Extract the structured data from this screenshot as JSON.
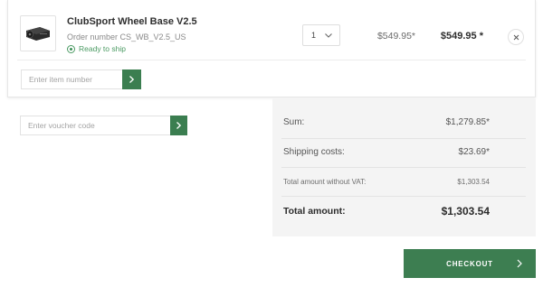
{
  "cart": {
    "item": {
      "product_name": "ClubSport Wheel Base V2.5",
      "order_number": "Order number CS_WB_V2.5_US",
      "stock_status": "Ready to ship",
      "quantity": "1",
      "unit_price": "$549.95*",
      "total_price": "$549.95 *",
      "thumbnail_icon": "wheel-base-product-image",
      "remove_icon": "close-icon"
    },
    "add_item": {
      "placeholder": "Enter item number",
      "button_icon": "chevron-right-icon"
    }
  },
  "voucher": {
    "placeholder": "Enter voucher code",
    "button_icon": "chevron-right-icon"
  },
  "summary": {
    "sum_label": "Sum:",
    "sum_value": "$1,279.85*",
    "shipping_label": "Shipping costs:",
    "shipping_value": "$23.69*",
    "novat_label": "Total amount without VAT:",
    "novat_value": "$1,303.54",
    "total_label": "Total amount:",
    "total_value": "$1,303.54"
  },
  "checkout": {
    "label": "CHECKOUT",
    "icon": "chevron-right-icon"
  },
  "colors": {
    "accent_green": "#3b7e50",
    "status_green": "#4a9a62",
    "summary_bg": "#f4f4f4"
  }
}
